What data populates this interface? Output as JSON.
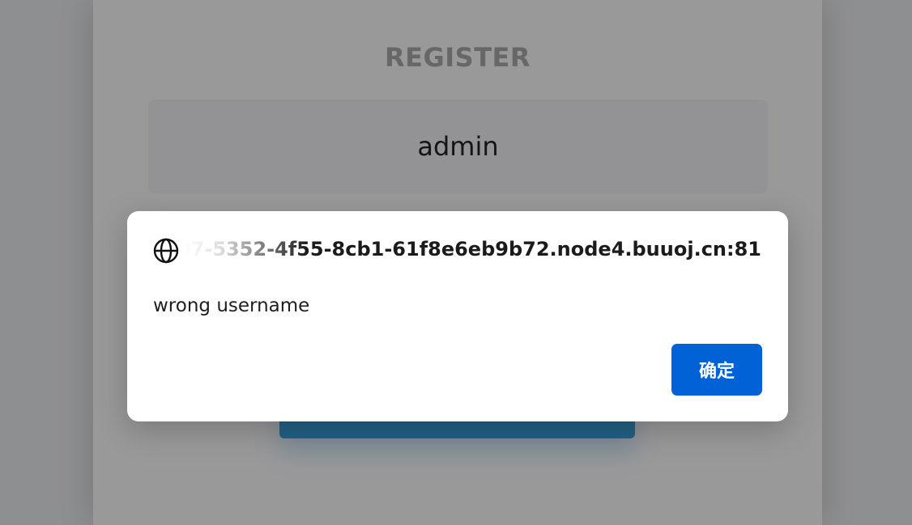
{
  "page": {
    "title": "REGISTER",
    "username_value": "admin",
    "register_button_label": ""
  },
  "alert": {
    "origin": "545e07-5352-4f55-8cb1-61f8e6eb9b72.node4.buuoj.cn:81",
    "origin_icon": "globe-icon",
    "message": "wrong username",
    "ok_label": "确定"
  },
  "colors": {
    "accent_button": "#0062d6",
    "register_button": "#3b9bd7"
  }
}
